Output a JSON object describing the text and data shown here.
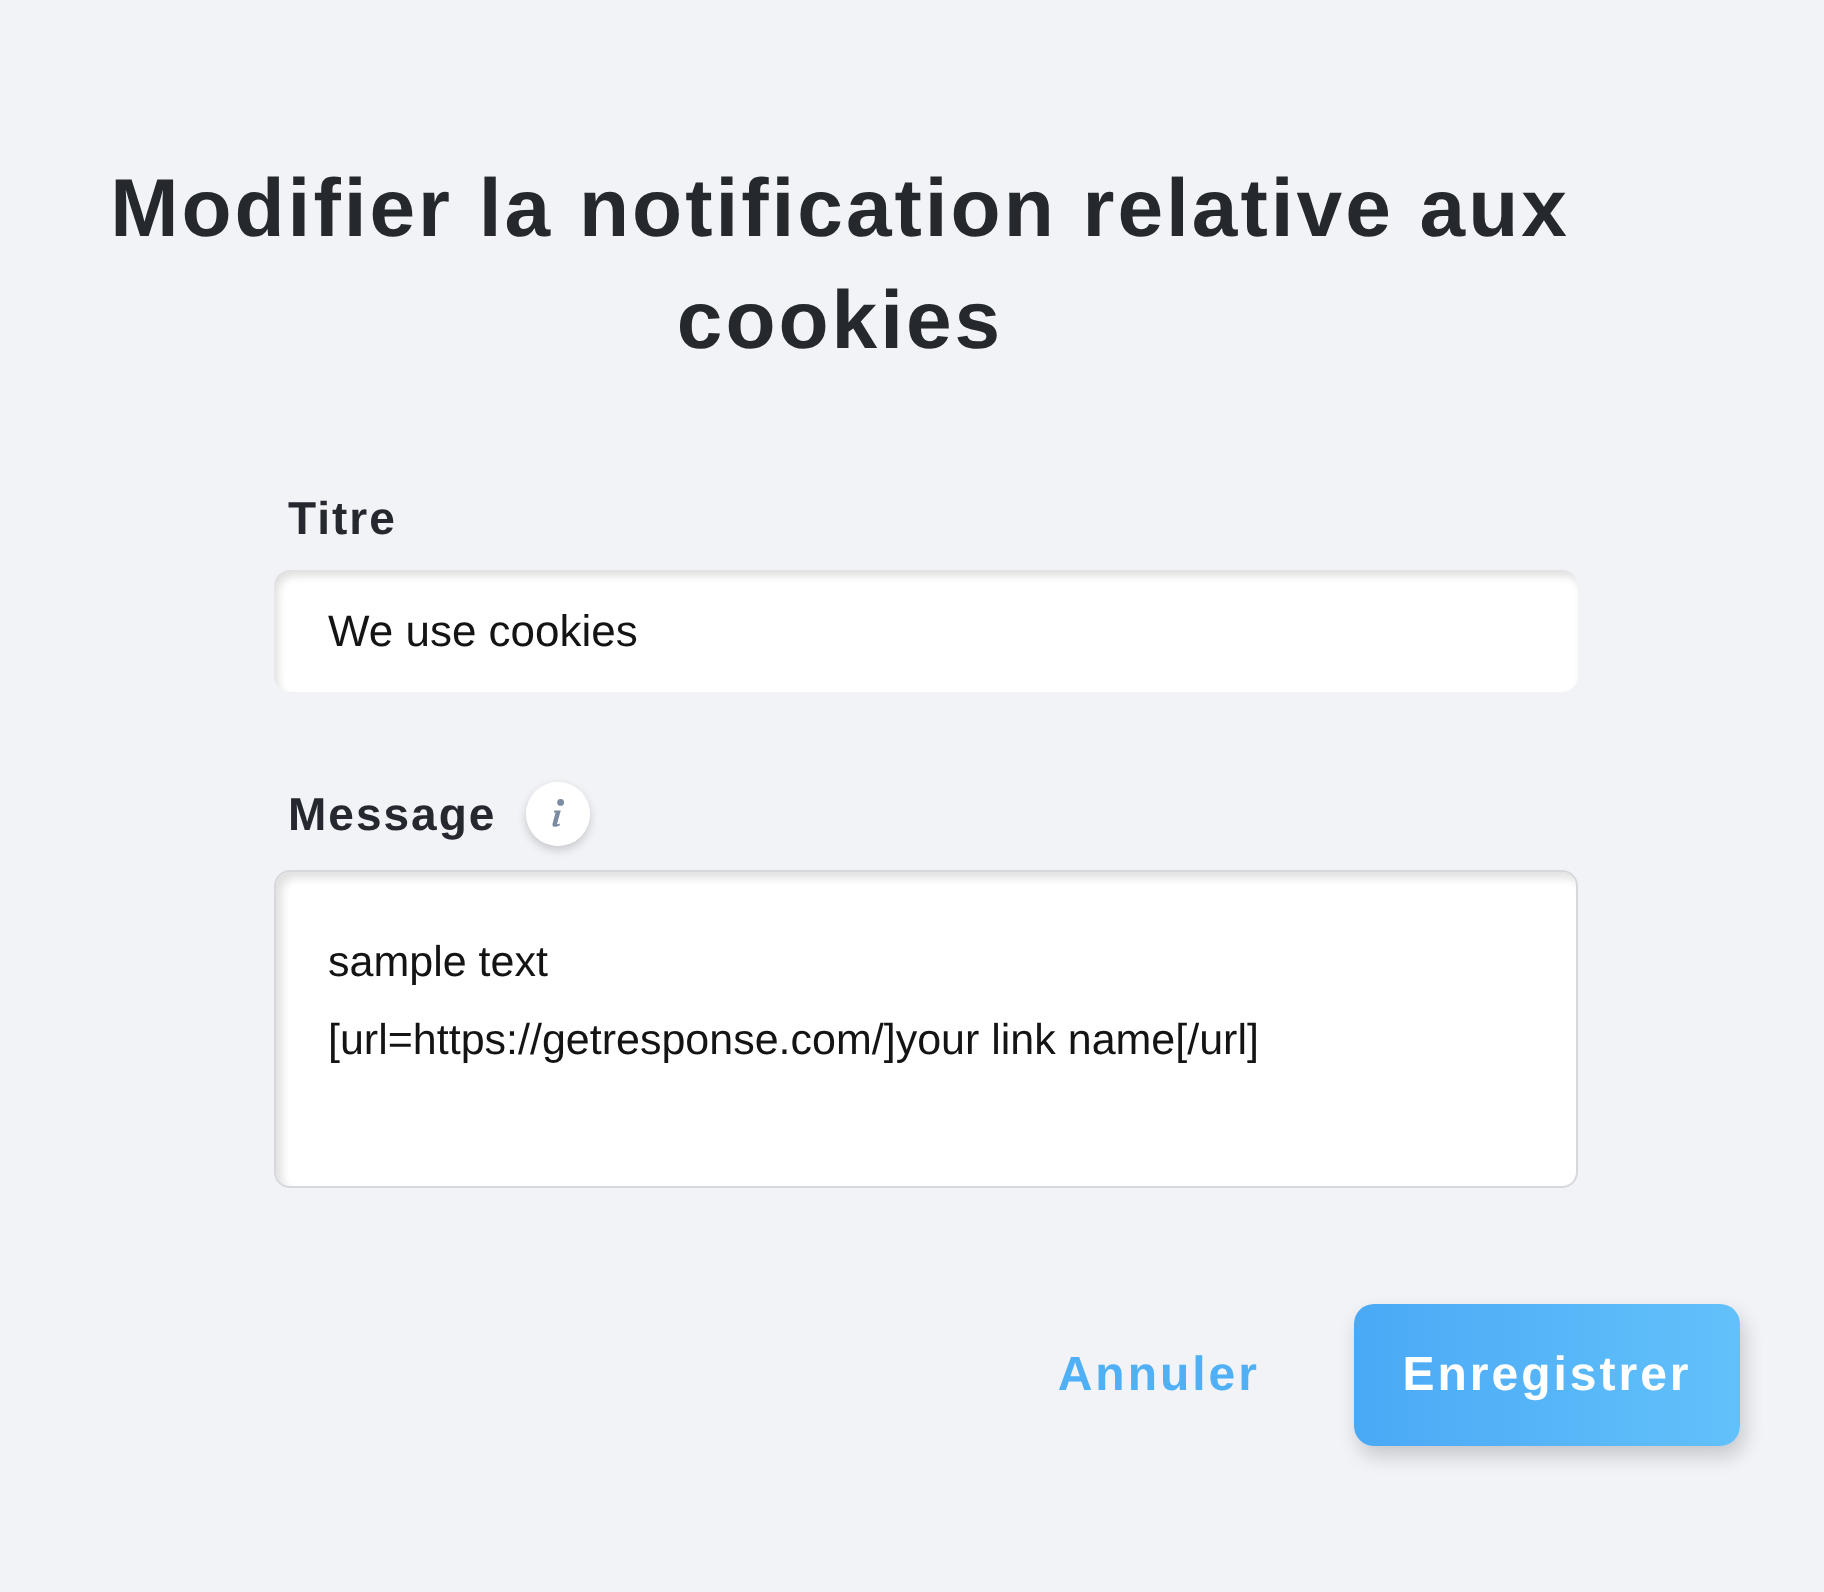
{
  "title": "Modifier la notification relative aux cookies",
  "fields": [
    {
      "kind": "input",
      "label": "Titre",
      "info": false,
      "value": "We use cookies"
    },
    {
      "kind": "textarea",
      "label": "Message",
      "info": true,
      "value": "sample text\n[url=https://getresponse.com/]your link name[/url]"
    }
  ],
  "actions": [
    {
      "kind": "link",
      "label": "Annuler"
    },
    {
      "kind": "primary",
      "label": "Enregistrer"
    }
  ]
}
